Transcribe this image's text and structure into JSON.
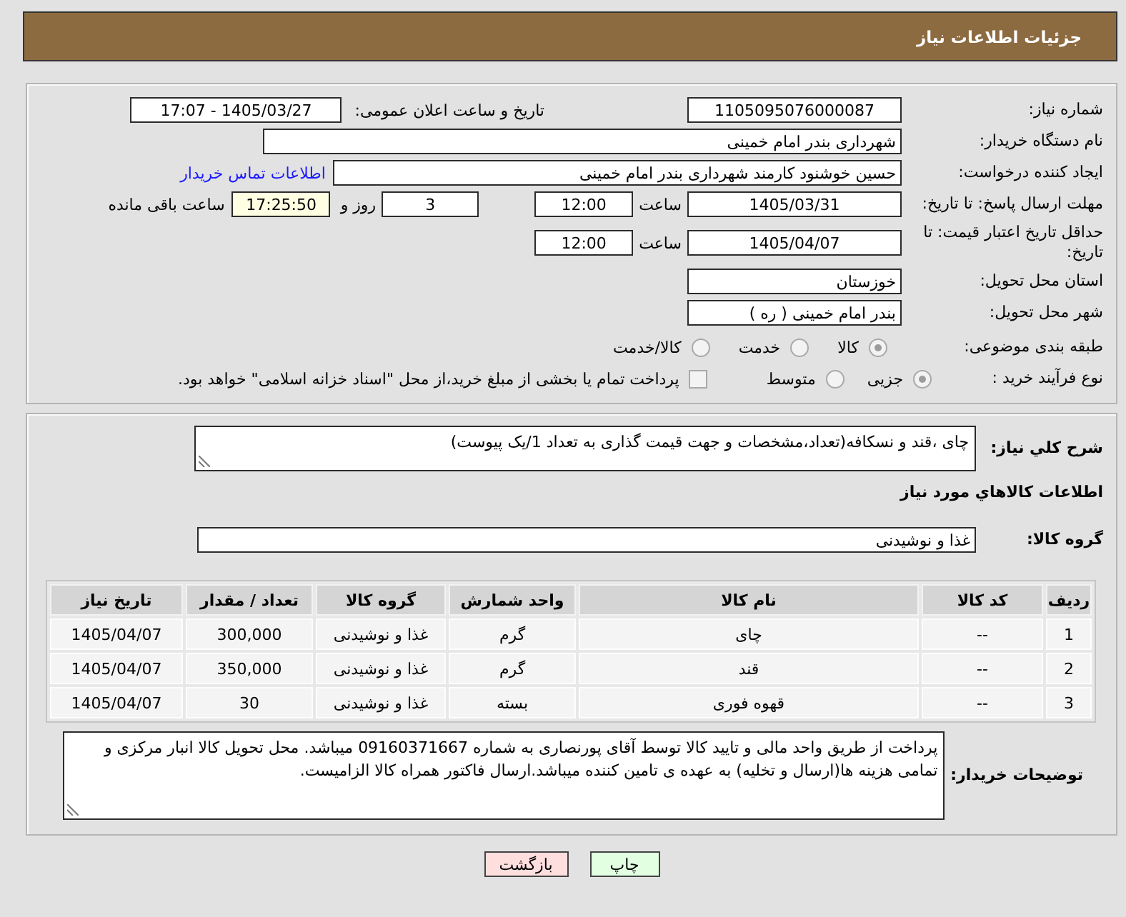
{
  "header": {
    "title": "جزئیات اطلاعات نیاز"
  },
  "details": {
    "need_number": {
      "label": "شماره نیاز:",
      "value": "1105095076000087"
    },
    "announcement": {
      "label": "تاریخ و ساعت اعلان عمومی:",
      "value": "1405/03/27 - 17:07"
    },
    "buyer_organization": {
      "label": "نام دستگاه خریدار:",
      "value": "شهرداری بندر امام خمینی"
    },
    "requester": {
      "label": "ایجاد کننده درخواست:",
      "value": "حسین خوشنود کارمند شهرداری بندر امام خمینی",
      "link": "اطلاعات تماس خریدار"
    },
    "response_deadline": {
      "label": "مهلت ارسال پاسخ: تا تاریخ:",
      "date": "1405/03/31",
      "time_label": "ساعت",
      "time": "12:00",
      "days": "3",
      "days_label": "روز و",
      "remaining": "17:25:50",
      "remaining_label": "ساعت باقی مانده"
    },
    "price_validity": {
      "label": "حداقل تاریخ اعتبار قیمت: تا تاریخ:",
      "date": "1405/04/07",
      "time_label": "ساعت",
      "time": "12:00"
    },
    "delivery_province": {
      "label": "استان محل تحویل:",
      "value": "خوزستان"
    },
    "delivery_city": {
      "label": "شهر محل تحویل:",
      "value": "بندر امام خمینی ( ره )"
    },
    "category": {
      "label": "طبقه بندی موضوعی:",
      "options": [
        {
          "label": "کالا",
          "selected": true
        },
        {
          "label": "خدمت",
          "selected": false
        },
        {
          "label": "کالا/خدمت",
          "selected": false
        }
      ]
    },
    "purchase_process": {
      "label": "نوع فرآیند خرید :",
      "options": [
        {
          "label": "جزیی",
          "selected": true
        },
        {
          "label": "متوسط",
          "selected": false
        }
      ],
      "treasury_payment": {
        "label": "پرداخت تمام یا بخشی از مبلغ خرید،از محل \"اسناد خزانه اسلامی\" خواهد بود.",
        "checked": false
      }
    }
  },
  "needs": {
    "summary": {
      "label": "شرح کلي نیاز:",
      "value": "چای ،قند و نسکافه(تعداد،مشخصات و جهت قیمت گذاری به تعداد 1/یک پیوست)"
    },
    "items_heading": "اطلاعات کالاهاي مورد نیاز",
    "goods_group": {
      "label": "گروه کالا:",
      "value": "غذا و نوشیدنی"
    },
    "items": {
      "columns": [
        "ردیف",
        "کد کالا",
        "نام کالا",
        "واحد شمارش",
        "گروه کالا",
        "تعداد / مقدار",
        "تاریخ نیاز"
      ],
      "rows": [
        [
          "1",
          "--",
          "چای",
          "گرم",
          "غذا و نوشیدنی",
          "300,000",
          "1405/04/07"
        ],
        [
          "2",
          "--",
          "قند",
          "گرم",
          "غذا و نوشیدنی",
          "350,000",
          "1405/04/07"
        ],
        [
          "3",
          "--",
          "قهوه فوری",
          "بسته",
          "غذا و نوشیدنی",
          "30",
          "1405/04/07"
        ]
      ]
    },
    "buyer_notes": {
      "label": "توضیحات خریدار:",
      "value": "پرداخت از طریق واحد مالی و تایید کالا توسط آقای پورنصاری به شماره 09160371667 میباشد. محل تحویل کالا انبار مرکزی و تمامی هزینه ها(ارسال و تخلیه) به عهده ی تامین کننده میباشد.ارسال فاکتور همراه کالا الزامیست."
    }
  },
  "buttons": [
    {
      "label": "چاپ",
      "kind": "print"
    },
    {
      "label": "بازگشت",
      "kind": "back"
    }
  ]
}
